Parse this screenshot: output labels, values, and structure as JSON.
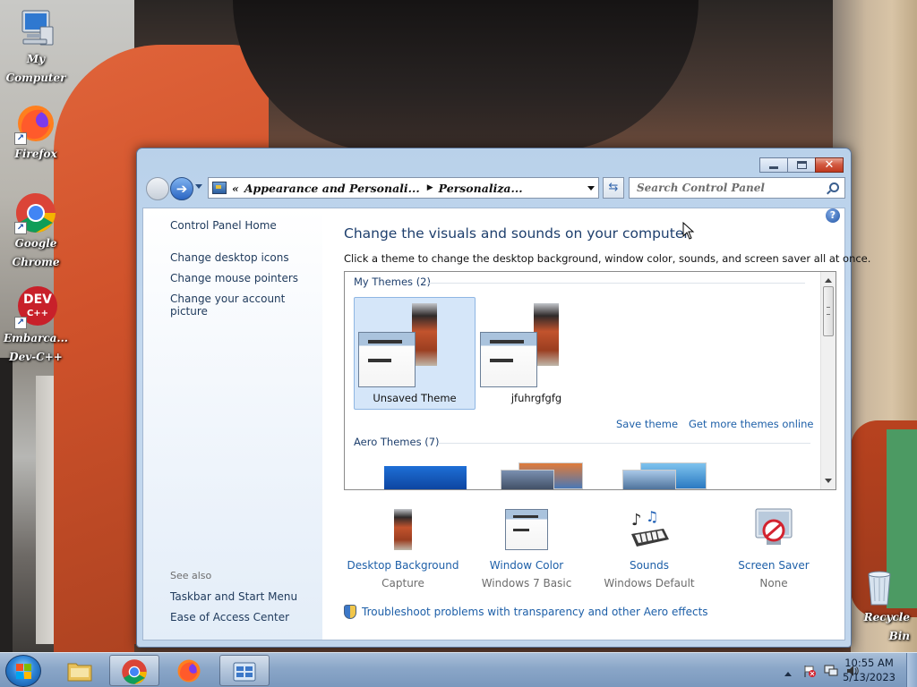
{
  "desktop": {
    "icons": [
      {
        "label": "My Computer"
      },
      {
        "label": "Firefox"
      },
      {
        "label": "Google Chrome"
      },
      {
        "label": "Embarca... Dev-C++"
      },
      {
        "label": "Recycle Bin"
      }
    ],
    "dev_logo_text": "DEV",
    "dev_logo_sub": "C++"
  },
  "window": {
    "address": {
      "chevron": "«",
      "segment1": "Appearance and Personali...",
      "segment2": "Personaliza..."
    },
    "search": {
      "placeholder": "Search Control Panel"
    },
    "left_pane": {
      "home": "Control Panel Home",
      "links": [
        "Change desktop icons",
        "Change mouse pointers",
        "Change your account picture"
      ],
      "see_also_label": "See also",
      "see_also_links": [
        "Taskbar and Start Menu",
        "Ease of Access Center"
      ]
    },
    "main": {
      "title": "Change the visuals and sounds on your computer",
      "subtitle": "Click a theme to change the desktop background, window color, sounds, and screen saver all at once.",
      "my_themes_label": "My Themes (2)",
      "my_themes": [
        {
          "name": "Unsaved Theme",
          "selected": true
        },
        {
          "name": "jfuhrgfgfg",
          "selected": false
        }
      ],
      "save_theme": "Save theme",
      "get_more": "Get more themes online",
      "aero_label": "Aero Themes (7)",
      "settings": [
        {
          "title": "Desktop Background",
          "value": "Capture",
          "icon": "desktop-background-icon"
        },
        {
          "title": "Window Color",
          "value": "Windows 7 Basic",
          "icon": "window-color-icon"
        },
        {
          "title": "Sounds",
          "value": "Windows Default",
          "icon": "sounds-icon"
        },
        {
          "title": "Screen Saver",
          "value": "None",
          "icon": "screen-saver-icon"
        }
      ],
      "troubleshoot": "Troubleshoot problems with transparency and other Aero effects"
    },
    "help_glyph": "?"
  },
  "taskbar": {
    "apps": [
      "File Explorer",
      "Google Chrome",
      "Firefox",
      "Control Panel"
    ],
    "active_app": "Google Chrome",
    "clock_time": "10:55 AM",
    "clock_date": "5/13/2023"
  },
  "colors": {
    "link": "#1d5fa8",
    "title": "#1e3f6d",
    "selected_theme_bg": "#d5e6f9"
  }
}
